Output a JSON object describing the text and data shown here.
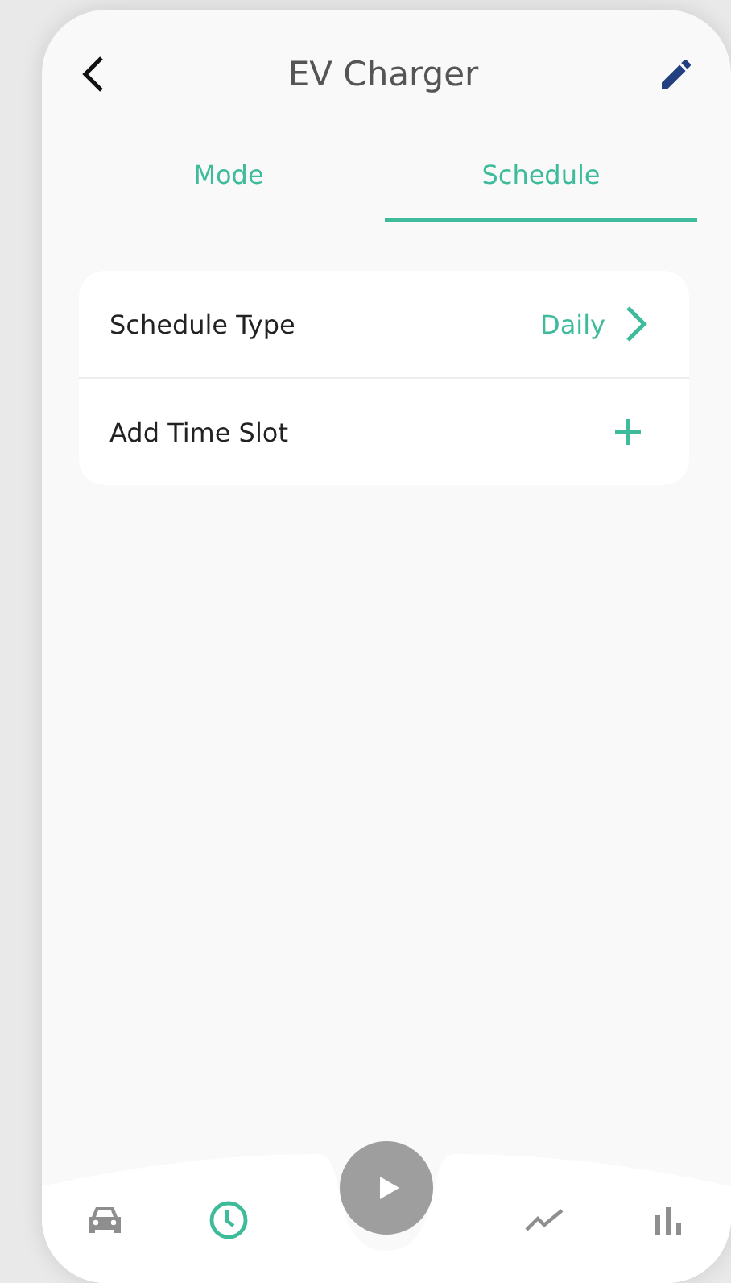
{
  "header": {
    "title": "EV Charger"
  },
  "tabs": [
    {
      "label": "Mode",
      "selected": false
    },
    {
      "label": "Schedule",
      "selected": true
    }
  ],
  "settings": [
    {
      "kind": "select",
      "label": "Schedule Type",
      "value": "Daily"
    },
    {
      "kind": "add",
      "label": "Add Time Slot"
    }
  ],
  "bottom_nav": [
    {
      "kind": "car",
      "selected": false
    },
    {
      "kind": "clock",
      "selected": true
    },
    {
      "kind": "play",
      "selected": false
    },
    {
      "kind": "trend",
      "selected": false
    },
    {
      "kind": "bars",
      "selected": false
    }
  ]
}
